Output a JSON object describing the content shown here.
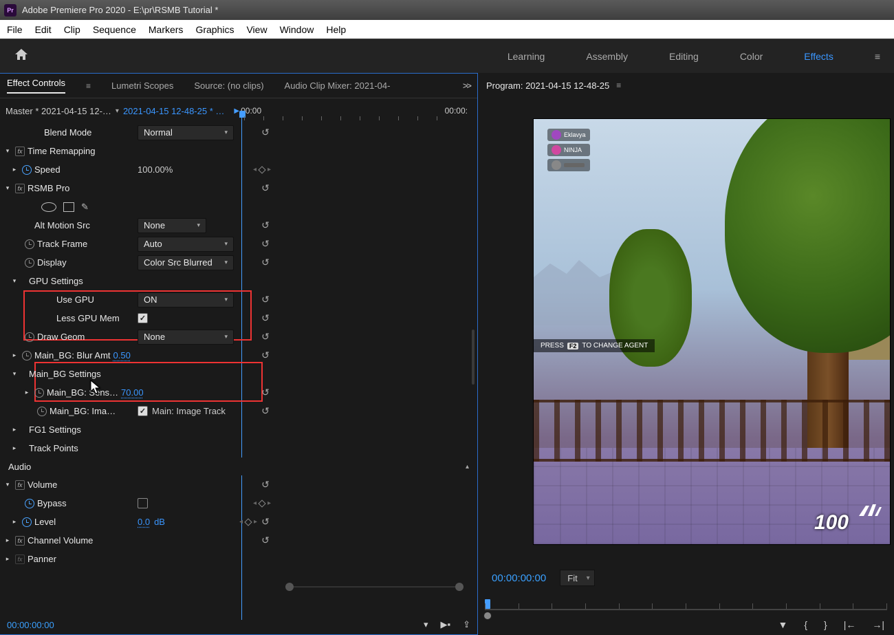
{
  "app": {
    "title": "Adobe Premiere Pro 2020 - E:\\pr\\RSMB Tutorial *"
  },
  "menu": [
    "File",
    "Edit",
    "Clip",
    "Sequence",
    "Markers",
    "Graphics",
    "View",
    "Window",
    "Help"
  ],
  "workspaces": {
    "tabs": [
      "Learning",
      "Assembly",
      "Editing",
      "Color",
      "Effects"
    ],
    "active": "Effects"
  },
  "leftTabs": {
    "items": [
      "Effect Controls",
      "Lumetri Scopes",
      "Source: (no clips)",
      "Audio Clip Mixer: 2021-04-"
    ],
    "active": "Effect Controls"
  },
  "clipRow": {
    "master": "Master * 2021-04-15 12-…",
    "active": "2021-04-15 12-48-25 * …",
    "tcLeft": "00:00",
    "tcRight": "00:00:"
  },
  "ec": {
    "blendMode": {
      "label": "Blend Mode",
      "value": "Normal"
    },
    "timeRemapping": {
      "label": "Time Remapping",
      "speedLabel": "Speed",
      "speedVal": "100.00%"
    },
    "rsmb": {
      "label": "RSMB Pro",
      "altMotion": {
        "label": "Alt Motion Src",
        "value": "None"
      },
      "trackFrame": {
        "label": "Track Frame",
        "value": "Auto"
      },
      "display": {
        "label": "Display",
        "value": "Color Src Blurred"
      },
      "gpu": {
        "label": "GPU Settings",
        "useGpuLabel": "Use GPU",
        "useGpuVal": "ON",
        "lessMemLabel": "Less GPU Mem"
      },
      "drawGeom": {
        "label": "Draw Geom",
        "value": "None"
      },
      "blurAmt": {
        "label": "Main_BG: Blur Amt",
        "value": "0.50"
      },
      "bgSettings": {
        "label": "Main_BG Settings"
      },
      "sens": {
        "label": "Main_BG: Sens…",
        "value": "70.00"
      },
      "imgTrack": {
        "label": "Main_BG: Ima…",
        "checkLabel": "Main: Image Track"
      },
      "fg1": {
        "label": "FG1 Settings"
      },
      "trackPoints": {
        "label": "Track Points"
      }
    },
    "audio": {
      "header": "Audio",
      "volume": {
        "label": "Volume",
        "bypass": "Bypass",
        "level": "Level",
        "levelVal": "0.0",
        "levelUnit": "dB"
      },
      "channelVolume": "Channel Volume",
      "panner": "Panner"
    }
  },
  "timecode": "00:00:00:00",
  "program": {
    "title": "Program: 2021-04-15 12-48-25",
    "tc": "00:00:00:00",
    "fit": "Fit",
    "hud": {
      "players": [
        {
          "name": "Eklavya",
          "color": "#a048c0"
        },
        {
          "name": "NINJA",
          "color": "#d048a0"
        },
        {
          "name": "",
          "color": "#888"
        }
      ],
      "msgPre": "PRESS",
      "msgKey": "F2",
      "msgPost": "TO CHANGE AGENT",
      "score": "100"
    }
  }
}
